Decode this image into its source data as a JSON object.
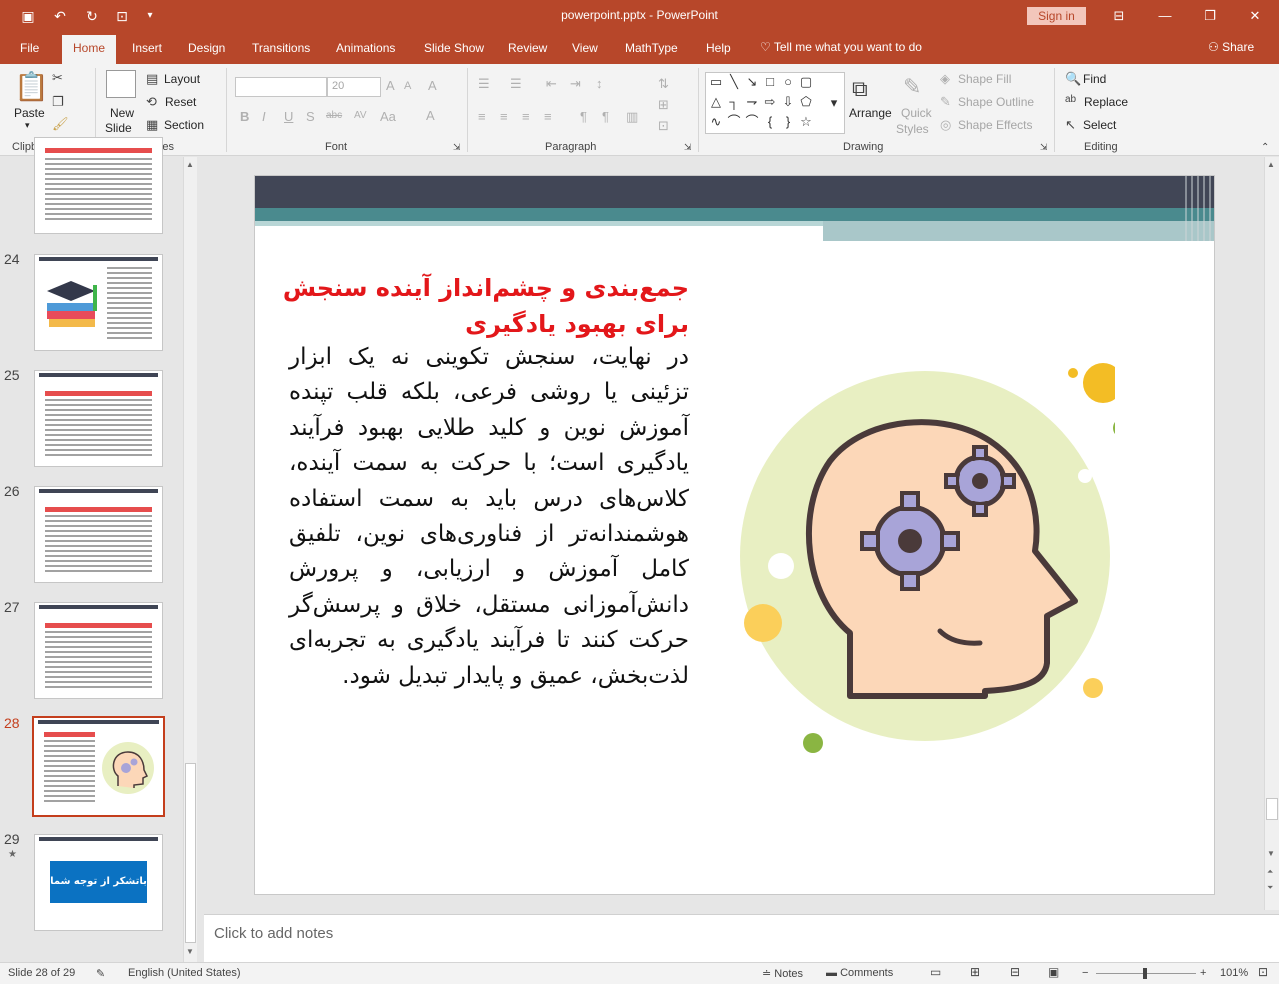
{
  "titlebar": {
    "document_title": "powerpoint.pptx  -  PowerPoint",
    "sign_in": "Sign in"
  },
  "tabs": [
    "File",
    "Home",
    "Insert",
    "Design",
    "Transitions",
    "Animations",
    "Slide Show",
    "Review",
    "View",
    "MathType",
    "Help"
  ],
  "tell_me": "Tell me what you want to do",
  "share": "Share",
  "ribbon": {
    "clipboard": {
      "paste": "Paste",
      "label": "Clipboard"
    },
    "slides": {
      "new_slide": "New",
      "new_slide2": "Slide",
      "layout": "Layout",
      "reset": "Reset",
      "section": "Section",
      "label": "Slides"
    },
    "font": {
      "size": "20",
      "label": "Font"
    },
    "paragraph": {
      "label": "Paragraph"
    },
    "drawing": {
      "arrange": "Arrange",
      "quick_styles": "Quick",
      "quick_styles2": "Styles",
      "shape_fill": "Shape Fill",
      "shape_outline": "Shape Outline",
      "shape_effects": "Shape Effects",
      "label": "Drawing"
    },
    "editing": {
      "find": "Find",
      "replace": "Replace",
      "select": "Select",
      "label": "Editing"
    }
  },
  "thumbnails": [
    {
      "num": "",
      "type": "text"
    },
    {
      "num": "24",
      "type": "books"
    },
    {
      "num": "25",
      "type": "text"
    },
    {
      "num": "26",
      "type": "text"
    },
    {
      "num": "27",
      "type": "text"
    },
    {
      "num": "28",
      "type": "head",
      "active": true
    },
    {
      "num": "29",
      "type": "thanks",
      "thanks_text": "باتشکر از توجه شما"
    }
  ],
  "slide": {
    "title": "جمع‌بندی و چشم‌انداز آینده سنجش برای بهبود یادگیری",
    "body": "در نهایت، سنجش تکوینی نه یک ابزار تزئینی یا روشی فرعی، بلکه قلب تپنده آموزش نوین و کلید طلایی بهبود فرآیند یادگیری است؛ با حرکت به سمت آینده، کلاس‌های درس باید به سمت استفاده هوشمندانه‌تر از فناوری‌های نوین، تلفیق کامل آموزش و ارزیابی، و پرورش دانش‌آموزانی مستقل، خلاق و پرسش‌گر حرکت کنند تا فرآیند یادگیری به تجربه‌ای لذت‌بخش، عمیق و پایدار تبدیل شود.",
    "colors": {
      "title": "#e3171a",
      "header": "#414656",
      "accent": "#4a8a8e"
    }
  },
  "notes_placeholder": "Click to add notes",
  "status": {
    "slide_counter": "Slide 28 of 29",
    "language": "English (United States)",
    "notes": "Notes",
    "comments": "Comments",
    "zoom": "101%"
  }
}
